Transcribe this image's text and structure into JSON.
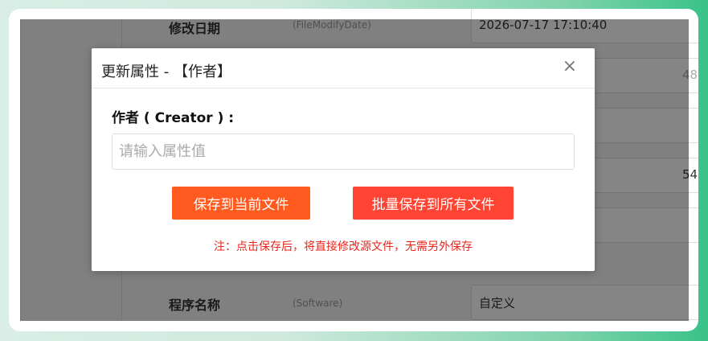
{
  "background_rows": [
    {
      "name": "修改日期",
      "key": "(FileModifyDate)",
      "value": "2026-07-17 17:10:40"
    },
    {
      "name": "",
      "key": "",
      "value": "48"
    },
    {
      "name": "",
      "key": "",
      "value": ""
    },
    {
      "name": "",
      "key": "",
      "value": "54"
    },
    {
      "name": "",
      "key": "",
      "value": ""
    },
    {
      "name": "程序名称",
      "key": "(Software)",
      "value": "自定义"
    }
  ],
  "dialog": {
    "title": "更新属性 - 【作者】",
    "close_glyph": "×",
    "field_label": "作者 ( Creator ) :",
    "input_placeholder": "请输入属性值",
    "input_value": "",
    "save_button": "保存到当前文件",
    "save_all_button": "批量保存到所有文件",
    "note": "注：点击保存后，将直接修改源文件，无需另外保存"
  },
  "colors": {
    "save_button": "#ff5a1f",
    "save_all_button": "#ff4434",
    "note": "#e8261c"
  }
}
